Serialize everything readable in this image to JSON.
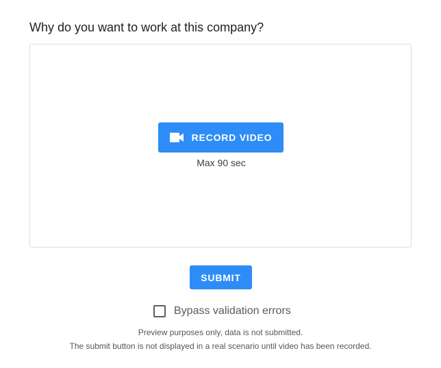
{
  "question": {
    "title": "Why do you want to work at this company?"
  },
  "recorder": {
    "record_label": "RECORD VIDEO",
    "record_icon": "video-camera-icon",
    "max_duration": "Max 90 sec"
  },
  "form": {
    "submit_label": "SUBMIT",
    "bypass_label": "Bypass validation errors",
    "bypass_checked": false
  },
  "notes": {
    "preview": "Preview purposes only, data is not submitted.",
    "submit_hidden": "The submit button is not displayed in a real scenario until video has been recorded."
  },
  "colors": {
    "accent": "#2e8cf6",
    "border": "#dedede",
    "text": "#212121",
    "muted": "#555555"
  }
}
